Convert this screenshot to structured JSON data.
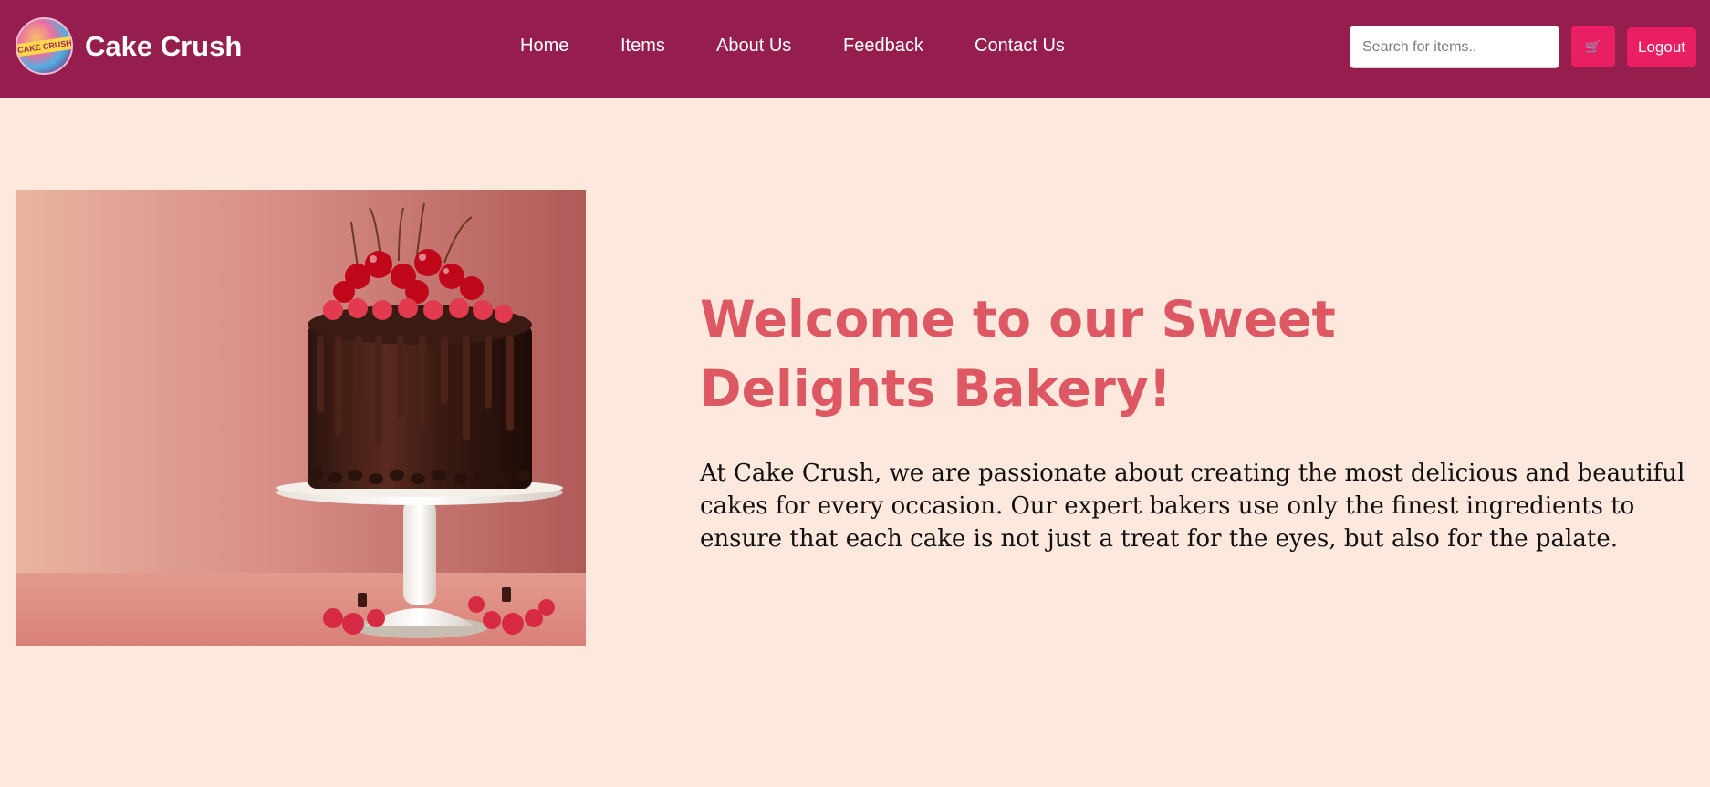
{
  "header": {
    "brand": "Cake Crush",
    "logo_text": "CAKE CRUSH",
    "nav": [
      "Home",
      "Items",
      "About Us",
      "Feedback",
      "Contact Us"
    ],
    "search_placeholder": "Search for items..",
    "cart_icon": "cart-icon",
    "logout_label": "Logout"
  },
  "hero": {
    "image_alt": "Chocolate drip cake with cherries and raspberries on a white cake stand",
    "title": "Welcome to our Sweet Delights Bakery!",
    "description": "At Cake Crush, we are passionate about creating the most delicious and beautiful cakes for every occasion. Our expert bakers use only the finest ingredients to ensure that each cake is not just a treat for the eyes, but also for the palate."
  },
  "colors": {
    "header_bg": "#951e4e",
    "accent_button": "#e91e63",
    "page_bg": "#fde8de",
    "title": "#de5864"
  }
}
